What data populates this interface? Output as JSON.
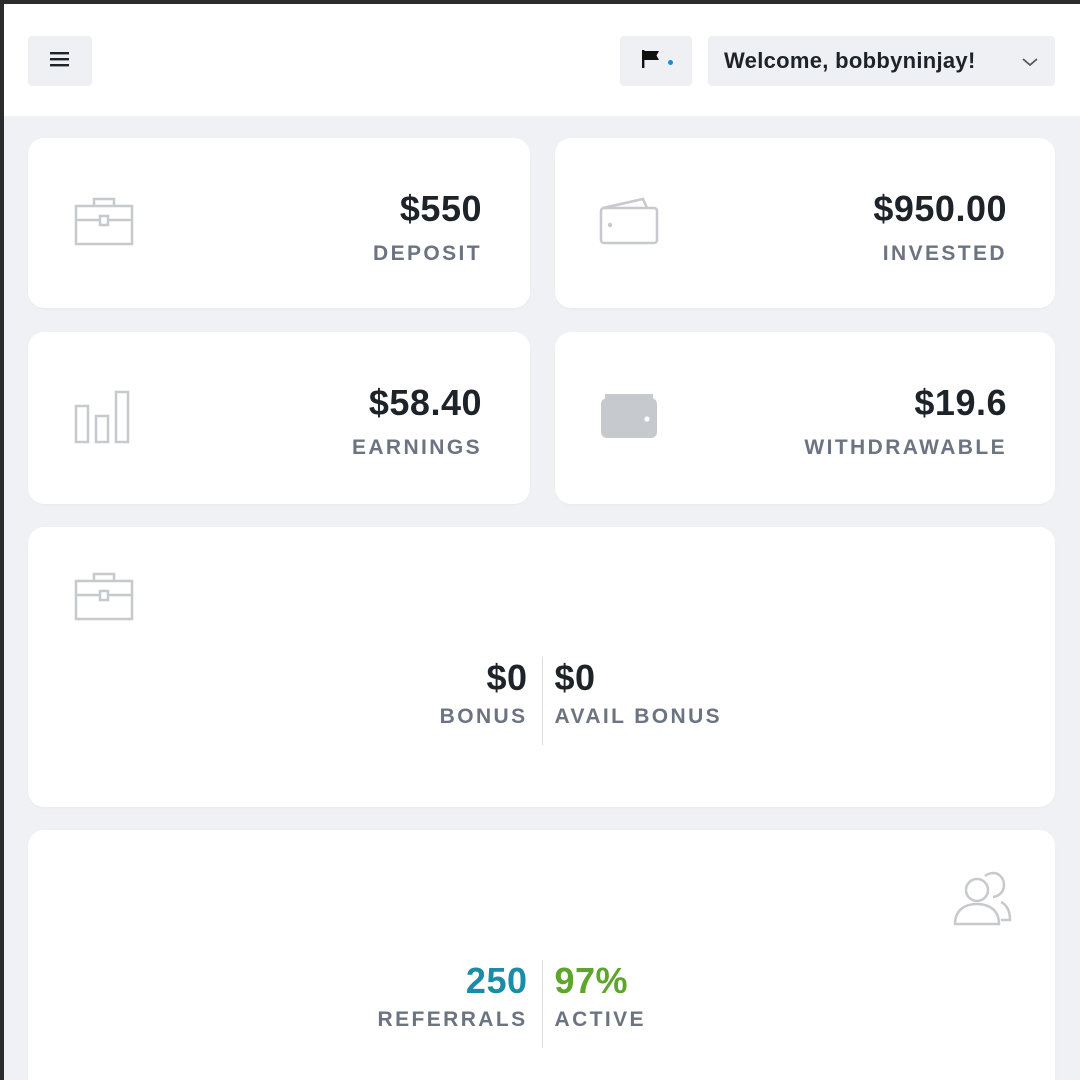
{
  "header": {
    "menu_icon": "hamburger-menu-icon",
    "flag_icon": "flag-icon",
    "welcome_text": "Welcome, bobbyninjay!",
    "dropdown_icon": "chevron-down-icon"
  },
  "stats": {
    "deposit": {
      "value": "$550",
      "label": "DEPOSIT",
      "icon": "briefcase-icon"
    },
    "invested": {
      "value": "$950.00",
      "label": "INVESTED",
      "icon": "wallet-outline-icon"
    },
    "earnings": {
      "value": "$58.40",
      "label": "EARNINGS",
      "icon": "bar-chart-icon"
    },
    "withdrawable": {
      "value": "$19.6",
      "label": "WITHDRAWABLE",
      "icon": "wallet-filled-icon"
    }
  },
  "bonus": {
    "icon": "briefcase-icon",
    "bonus_value": "$0",
    "bonus_label": "BONUS",
    "avail_value": "$0",
    "avail_label": "AVAIL BONUS"
  },
  "referrals": {
    "icon": "users-icon",
    "count_value": "250",
    "count_label": "REFERRALS",
    "active_value": "97%",
    "active_label": "ACTIVE"
  },
  "colors": {
    "referrals_accent": "#1a8ca8",
    "active_accent": "#5fa52b",
    "icon_gray": "#c6c9cd"
  }
}
